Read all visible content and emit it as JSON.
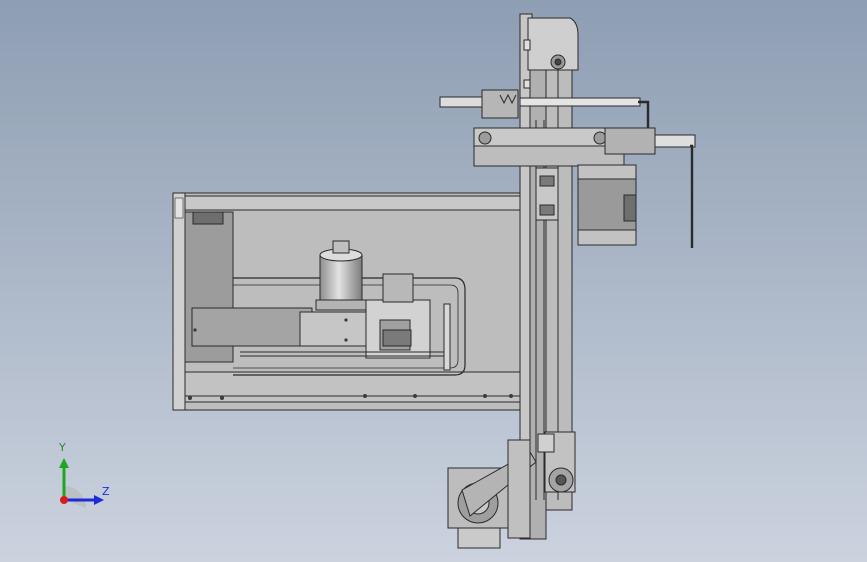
{
  "viewport": {
    "background_top": "#8e9eb3",
    "background_bottom": "#ccd3df",
    "model_fill": "#c9c9c9",
    "model_dark": "#8a8a8a",
    "edge_color": "#2a2a2a"
  },
  "triad": {
    "y_label": "Y",
    "z_label": "Z",
    "y_color": "#1fa51f",
    "z_color": "#1b2bd8",
    "x_color": "#d81b1b"
  }
}
